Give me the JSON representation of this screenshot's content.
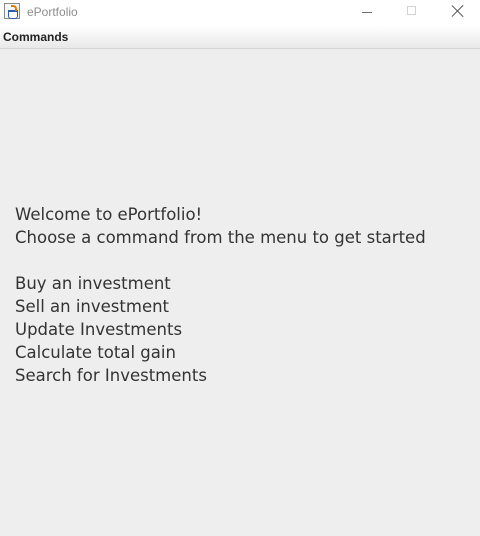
{
  "window": {
    "title": "ePortfolio",
    "icon": "java-cup-icon",
    "controls": [
      "minimize-icon",
      "maximize-icon",
      "close-icon"
    ]
  },
  "menubar": {
    "commands_label": "Commands"
  },
  "main": {
    "welcome": "Welcome to ePortfolio!",
    "instruction": "Choose a command from the menu to get started",
    "options": [
      "Buy an investment",
      "Sell an investment",
      "Update Investments",
      "Calculate total gain",
      "Search for Investments"
    ]
  }
}
